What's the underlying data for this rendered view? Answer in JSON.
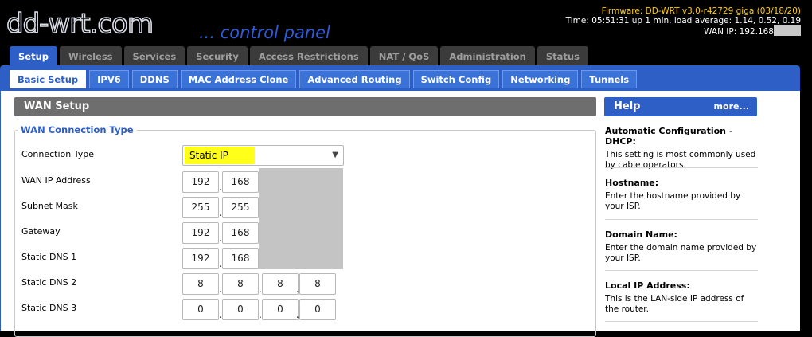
{
  "header": {
    "logo": "dd-wrt.com",
    "tagline": "... control panel",
    "firmware": "Firmware: DD-WRT v3.0-r42729 giga (03/18/20)",
    "time": "Time: 05:51:31 up 1 min, load average: 1.14, 0.52, 0.19",
    "wan_ip": "WAN IP: 192.168"
  },
  "main_tabs": [
    "Setup",
    "Wireless",
    "Services",
    "Security",
    "Access Restrictions",
    "NAT / QoS",
    "Administration",
    "Status"
  ],
  "sub_tabs": [
    "Basic Setup",
    "IPV6",
    "DDNS",
    "MAC Address Clone",
    "Advanced Routing",
    "Switch Config",
    "Networking",
    "Tunnels"
  ],
  "wan": {
    "section_title": "WAN Setup",
    "legend": "WAN Connection Type",
    "connection_type_label": "Connection Type",
    "connection_type_value": "Static IP",
    "wan_ip_label": "WAN IP Address",
    "wan_ip": [
      "192",
      "168"
    ],
    "subnet_label": "Subnet Mask",
    "subnet": [
      "255",
      "255"
    ],
    "gateway_label": "Gateway",
    "gateway": [
      "192",
      "168"
    ],
    "dns1_label": "Static DNS 1",
    "dns1": [
      "192",
      "168"
    ],
    "dns2_label": "Static DNS 2",
    "dns2": [
      "8",
      "8",
      "8",
      "8"
    ],
    "dns3_label": "Static DNS 3",
    "dns3": [
      "0",
      "0",
      "0",
      "0"
    ]
  },
  "help": {
    "title": "Help",
    "more": "more...",
    "items": [
      {
        "title": "Automatic Configuration - DHCP:",
        "text": "This setting is most commonly used by cable operators."
      },
      {
        "title": "Hostname:",
        "text": "Enter the hostname provided by your ISP."
      },
      {
        "title": "Domain Name:",
        "text": "Enter the domain name provided by your ISP."
      },
      {
        "title": "Local IP Address:",
        "text": "This is the LAN-side IP address of the router."
      }
    ]
  },
  "colors": {
    "accent": "#2d5fc7",
    "firmware_text": "#ffcc00",
    "highlight": "#ffff19"
  }
}
